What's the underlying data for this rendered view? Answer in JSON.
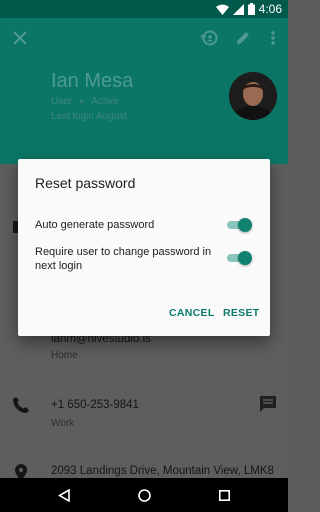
{
  "status_bar": {
    "time": "4:06"
  },
  "contact": {
    "name": "Ian Mesa",
    "role": "User",
    "state": "Active",
    "last_login": "Last login August"
  },
  "details": {
    "email_partial": "ianm@hivestudio.is",
    "email_type": "Home",
    "phone": "+1 650-253-9841",
    "phone_type": "Work",
    "address": "2093 Landings Drive, Mountain View, LMK8"
  },
  "dialog": {
    "title": "Reset password",
    "option_auto": "Auto generate password",
    "option_require": "Require user to change password in next login",
    "option_auto_on": true,
    "option_require_on": true,
    "cancel_label": "CANCEL",
    "reset_label": "RESET"
  },
  "colors": {
    "primary": "#0b7665",
    "accent": "#10826f"
  },
  "icons": [
    "close-icon",
    "restore-icon",
    "edit-icon",
    "more-vert-icon",
    "phone-icon",
    "message-icon",
    "location-icon",
    "back-icon",
    "home-icon",
    "recents-icon"
  ]
}
